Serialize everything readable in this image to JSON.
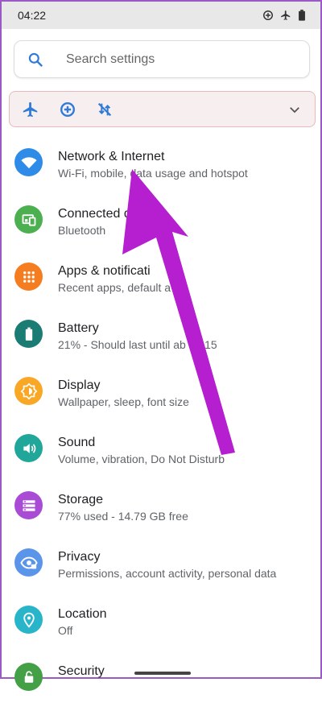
{
  "status": {
    "time": "04:22"
  },
  "search": {
    "placeholder": "Search settings"
  },
  "colors": {
    "network": "#2f8be8",
    "connected": "#4caf50",
    "apps": "#f57c1f",
    "battery": "#1b7c74",
    "display": "#f9a825",
    "sound": "#21a79a",
    "storage": "#a94bd4",
    "privacy": "#5b95e9",
    "location": "#28b5c9",
    "security": "#43a047",
    "arrow": "#b51fcf"
  },
  "items": [
    {
      "title": "Network & Internet",
      "subtitle": "Wi-Fi, mobile, data usage and hotspot",
      "icon": "wifi-icon"
    },
    {
      "title": "Connected de",
      "subtitle": "Bluetooth",
      "icon": "devices-icon"
    },
    {
      "title": "Apps & notificati",
      "subtitle": "Recent apps, default a",
      "icon": "apps-grid-icon"
    },
    {
      "title": "Battery",
      "subtitle": "21% - Should last until ab 04:15",
      "icon": "battery-icon"
    },
    {
      "title": "Display",
      "subtitle": "Wallpaper, sleep, font size",
      "icon": "brightness-icon"
    },
    {
      "title": "Sound",
      "subtitle": "Volume, vibration, Do Not Disturb",
      "icon": "volume-icon"
    },
    {
      "title": "Storage",
      "subtitle": "77% used - 14.79 GB free",
      "icon": "storage-icon"
    },
    {
      "title": "Privacy",
      "subtitle": "Permissions, account activity, personal data",
      "icon": "eye-icon"
    },
    {
      "title": "Location",
      "subtitle": "Off",
      "icon": "location-pin-icon"
    },
    {
      "title": "Security",
      "subtitle": "",
      "icon": "lock-icon"
    }
  ]
}
